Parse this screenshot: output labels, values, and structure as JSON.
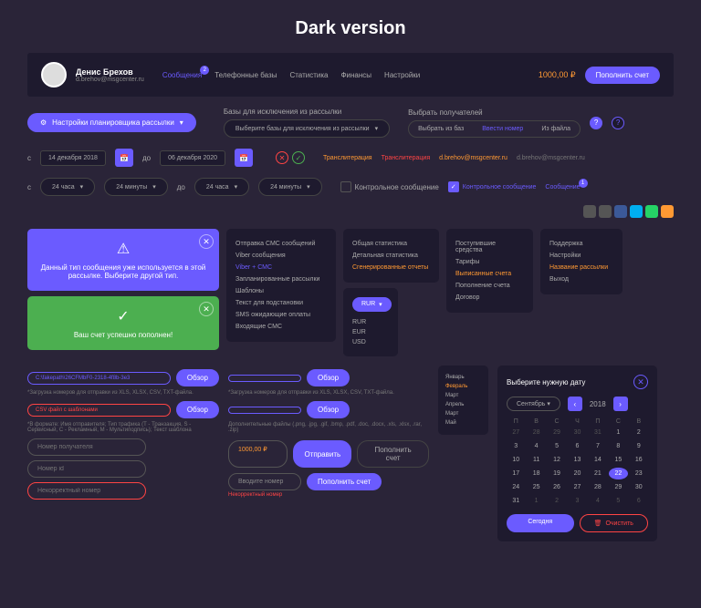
{
  "title": "Dark version",
  "user": {
    "name": "Денис Брехов",
    "email": "d.brehov@msgcenter.ru"
  },
  "nav": {
    "0": "Сообщения",
    "1": "Телефонные базы",
    "2": "Статистика",
    "3": "Финансы",
    "4": "Настройки",
    "badge": "2"
  },
  "balance": "1000,00 ₽",
  "topup": "Пополнить счет",
  "scheduler": "Настройки планировщика рассылки",
  "exclude": {
    "label": "Базы для исключения из рассылки",
    "drop": "Выберите базы для исключения из рассылки"
  },
  "recipients": {
    "label": "Выбрать получателей",
    "fromdb": "Выбрать из баз",
    "manual": "Ввести номер",
    "fromfile": "Из файла"
  },
  "dates": {
    "s": "с",
    "from": "14 декабря 2018",
    "do": "до",
    "to": "06 декабря 2020"
  },
  "translit": {
    "a": "Транслитерация",
    "b": "Транслитерация"
  },
  "emails": {
    "a": "d.brehov@msgcenter.ru",
    "b": "d.brehov@msgcenter.ru"
  },
  "time": {
    "h1": "24 часа",
    "m1": "24 минуты",
    "do": "до",
    "h2": "24 часа",
    "m2": "24 минуты"
  },
  "control": {
    "unchecked": "Контрольное сообщение",
    "checked": "Контрольное сообщение",
    "link": "Сообщение",
    "badge": "1"
  },
  "alerts": {
    "warn": "Данный тип сообщения уже используется в этой рассылке. Выберите другой тип.",
    "success": "Ваш счет успешно пополнен!"
  },
  "menu1": {
    "0": "Отправка СМС сообщений",
    "1": "Viber сообщения",
    "2": "Viber + СМС",
    "3": "Запланированные рассылки",
    "4": "Шаблоны",
    "5": "Текст для подстановки",
    "6": "SMS ожидающие оплаты",
    "7": "Входящие СМС"
  },
  "menu2": {
    "0": "Общая статистика",
    "1": "Детальная статистика",
    "2": "Сгенерированные отчеты"
  },
  "menu3": {
    "0": "Поступившие средства",
    "1": "Тарифы",
    "2": "Выписанные счета",
    "3": "Пополнение счета",
    "4": "Договор"
  },
  "menu4": {
    "0": "Поддержка",
    "1": "Настройки",
    "2": "Название рассылки",
    "3": "Выход"
  },
  "currency": {
    "sel": "RUR",
    "0": "RUR",
    "1": "EUR",
    "2": "USD"
  },
  "files": {
    "f1": "C:\\fakepath\\26CFMbF0-2318-4f8b-3e3",
    "f2": "CSV файл с шаблонами",
    "browse": "Обзор",
    "hint1": "*Загрузка номеров для отправки из XLS, XLSX, CSV, TXT-файла.",
    "hint2": "*В формате: Имя отправителя; Тип трафика (Т - Транзакция, S - Сервисный, C - Рекламный, M - Мультиподпись); Текст шаблона",
    "hint3": "*Загрузка номеров для отправки из XLS, XLSX, CSV, TXT-файла.",
    "hint4": "Дополнительные файлы (.png, .jpg, .gif, .bmp, .pdf, .doc, .docx, .xls, .xlsx, .rar, .zip)"
  },
  "inputs": {
    "recipient": "Номер получателя",
    "numberid": "Номер id",
    "badnumber": "Некорректный номер",
    "amount": "1000,00 ₽",
    "send": "Отправить",
    "balance2": "Пополнить счет",
    "balance3": "Пополнить счет",
    "enternum": "Вводите номер",
    "wrongnum": "Некорректный номер"
  },
  "months": {
    "0": "Январь",
    "1": "Февраль",
    "2": "Март",
    "3": "Апрель",
    "4": "Март",
    "5": "Май"
  },
  "datepicker": {
    "title": "Выберите нужную дату",
    "month": "Сентябрь",
    "year": "2018",
    "today": "Сегодня",
    "clear": "Очистить",
    "dow": {
      "0": "П",
      "1": "В",
      "2": "С",
      "3": "Ч",
      "4": "П",
      "5": "С",
      "6": "В"
    }
  }
}
